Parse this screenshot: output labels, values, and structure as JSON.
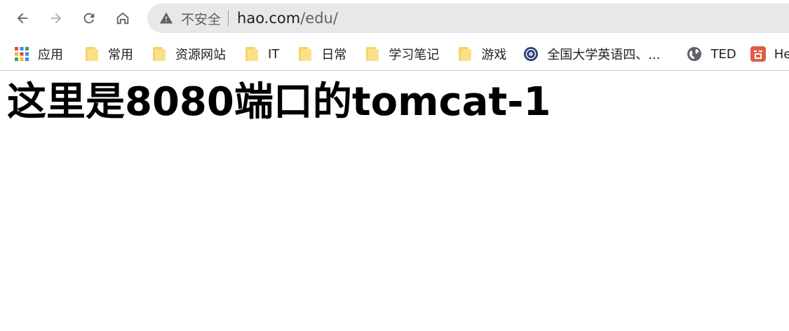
{
  "browser": {
    "omnibox": {
      "security_label": "不安全",
      "url_host": "hao.com",
      "url_path": "/edu/"
    },
    "bookmarks": [
      {
        "label": "应用",
        "icon": "apps-grid-icon"
      },
      {
        "label": "常用",
        "icon": "folder-icon"
      },
      {
        "label": "资源网站",
        "icon": "folder-icon"
      },
      {
        "label": "IT",
        "icon": "folder-icon"
      },
      {
        "label": "日常",
        "icon": "folder-icon"
      },
      {
        "label": "学习笔记",
        "icon": "folder-icon"
      },
      {
        "label": "游戏",
        "icon": "folder-icon"
      },
      {
        "label": "全国大学英语四、...",
        "icon": "cet-logo-icon"
      },
      {
        "label": "TED",
        "icon": "globe-icon"
      },
      {
        "label": "He",
        "icon": "jianshu-icon"
      }
    ]
  },
  "page": {
    "heading": "这里是8080端口的tomcat-1"
  },
  "colors": {
    "omnibox_bg": "#e8e8e8",
    "folder": "#fbe08a",
    "jianshu": "#e05d44"
  }
}
